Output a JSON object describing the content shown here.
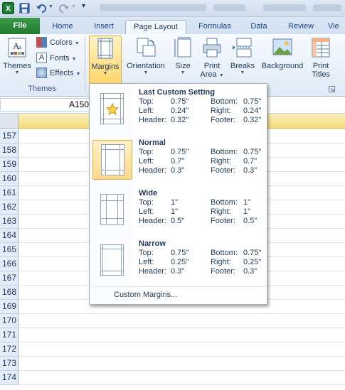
{
  "tabs": [
    "File",
    "Home",
    "Insert",
    "Page Layout",
    "Formulas",
    "Data",
    "Review",
    "Vie"
  ],
  "ribbon": {
    "themes": {
      "label": "Themes",
      "colors": "Colors",
      "fonts": "Fonts",
      "effects": "Effects",
      "group": "Themes"
    },
    "buttons": {
      "margins": "Margins",
      "orientation": "Orientation",
      "size": "Size",
      "print_area_1": "Print",
      "print_area_2": "Area",
      "breaks": "Breaks",
      "background": "Background",
      "print_titles_1": "Print",
      "print_titles_2": "Titles"
    }
  },
  "name_box": "A150",
  "rows": [
    "157",
    "158",
    "159",
    "160",
    "161",
    "162",
    "163",
    "164",
    "165",
    "166",
    "167",
    "168",
    "169",
    "170",
    "171",
    "172",
    "173",
    "174"
  ],
  "margins_menu": {
    "options": [
      {
        "title": "Last Custom Setting",
        "top": "0.75\"",
        "bottom": "0.75\"",
        "left": "0.24\"",
        "right": "0.24\"",
        "header": "0.32\"",
        "footer": "0.32\""
      },
      {
        "title": "Normal",
        "top": "0.75\"",
        "bottom": "0.75\"",
        "left": "0.7\"",
        "right": "0.7\"",
        "header": "0.3\"",
        "footer": "0.3\""
      },
      {
        "title": "Wide",
        "top": "1\"",
        "bottom": "1\"",
        "left": "1\"",
        "right": "1\"",
        "header": "0.5\"",
        "footer": "0.5\""
      },
      {
        "title": "Narrow",
        "top": "0.75\"",
        "bottom": "0.75\"",
        "left": "0.25\"",
        "right": "0.25\"",
        "header": "0.3\"",
        "footer": "0.3\""
      }
    ],
    "labels": {
      "top": "Top:",
      "bottom": "Bottom:",
      "left": "Left:",
      "right": "Right:",
      "header": "Header:",
      "footer": "Footer:"
    },
    "custom": "Custom Margins..."
  }
}
